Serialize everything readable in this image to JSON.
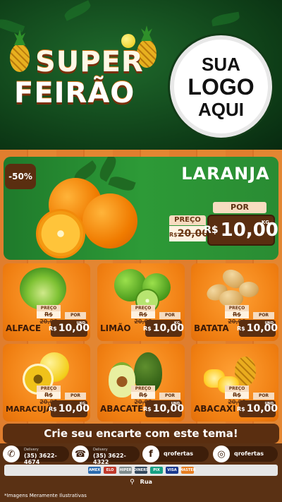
{
  "header": {
    "title_line1": "SUPER",
    "title_line2": "FEIRÃO",
    "logo_line1": "SUA",
    "logo_line2": "LOGO",
    "logo_line3": "AQUI"
  },
  "featured": {
    "discount": "-50%",
    "name": "LARANJA",
    "preco_label": "PREÇO",
    "old_currency": "R$",
    "old_price": "20,00",
    "por_label": "POR",
    "currency": "R$",
    "price": "10,00",
    "unit": "KG"
  },
  "products": [
    {
      "name": "ALFACE",
      "preco_label": "PREÇO",
      "old_price": "R$ 20,00",
      "por_label": "POR",
      "currency": "R$",
      "price": "10,00",
      "unit": "UND"
    },
    {
      "name": "LIMÃO",
      "preco_label": "PREÇO",
      "old_price": "R$ 20,00",
      "por_label": "POR",
      "currency": "R$",
      "price": "10,00",
      "unit": "KG"
    },
    {
      "name": "BATATA",
      "preco_label": "PREÇO",
      "old_price": "R$ 20,00",
      "por_label": "POR",
      "currency": "R$",
      "price": "10,00",
      "unit": "UND"
    },
    {
      "name": "MARACUJÁ",
      "preco_label": "PREÇO",
      "old_price": "R$ 20,00",
      "por_label": "POR",
      "currency": "R$",
      "price": "10,00",
      "unit": "KG"
    },
    {
      "name": "ABACATE",
      "preco_label": "PREÇO",
      "old_price": "R$ 20,00",
      "por_label": "POR",
      "currency": "R$",
      "price": "10,00",
      "unit": "UND"
    },
    {
      "name": "ABACAXI",
      "preco_label": "PREÇO",
      "old_price": "R$ 20,00",
      "por_label": "POR",
      "currency": "R$",
      "price": "10,00",
      "unit": "UND"
    }
  ],
  "cta": "Crie seu encarte com este tema!",
  "contact": {
    "whatsapp_label": "Delivery",
    "whatsapp_number": "(35) 3622-4674",
    "phone_label": "Delivery",
    "phone_number": "(35) 3622-4322",
    "facebook": "qrofertas",
    "instagram": "qrofertas"
  },
  "payments": [
    "AMEX",
    "ELO",
    "HIPER",
    "DINERS",
    "PIX",
    "VISA",
    "MASTER"
  ],
  "address": "Rua",
  "footnote": "*Imagens Meramente Ilustrativas",
  "colors": {
    "green": "#1f7a2b",
    "orange": "#f07f12",
    "brown": "#5a2e10"
  }
}
